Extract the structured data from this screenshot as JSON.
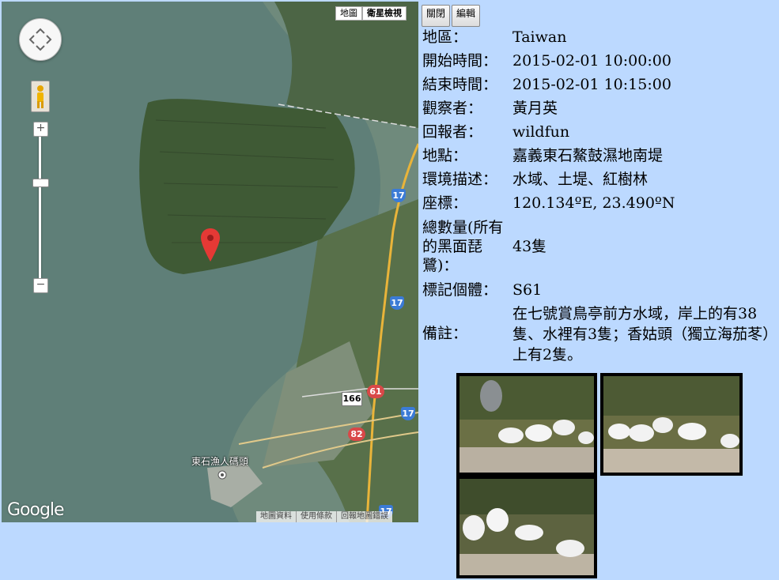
{
  "map": {
    "type_buttons": [
      "地圖",
      "衛星檢視"
    ],
    "zoom_in": "+",
    "zoom_out": "−",
    "logo": "Google",
    "place_label": "東石漁人碼頭",
    "footer": [
      "地圖資料",
      "使用條款",
      "回報地圖錯誤"
    ],
    "road_shields": {
      "r17a": "17",
      "r17b": "17",
      "r17c": "17",
      "r17d": "17",
      "r61": "61",
      "r82": "82",
      "r166": "166"
    }
  },
  "panel": {
    "buttons": [
      "關閉",
      "編輯"
    ],
    "rows": [
      {
        "key": "地區：",
        "value": "Taiwan"
      },
      {
        "key": "開始時間：",
        "value": "2015-02-01 10:00:00"
      },
      {
        "key": "結束時間：",
        "value": "2015-02-01 10:15:00"
      },
      {
        "key": "觀察者：",
        "value": "黃月英"
      },
      {
        "key": "回報者：",
        "value": "wildfun"
      },
      {
        "key": "地點：",
        "value": "嘉義東石鰲鼓濕地南堤"
      },
      {
        "key": "環境描述：",
        "value": "水域、土堤、紅樹林"
      },
      {
        "key": "座標：",
        "value": "120.134ºE, 23.490ºN"
      },
      {
        "key": "總數量(所有的黑面琵鷺)：",
        "value": "43隻"
      },
      {
        "key": "標記個體：",
        "value": "S61"
      },
      {
        "key": "備註：",
        "value": "在七號賞鳥亭前方水域，岸上的有38隻、水裡有3隻；香姑頭（獨立海茄苳）上有2隻。"
      }
    ]
  },
  "photos": [
    "spoonbills-photo-1",
    "spoonbills-photo-2",
    "spoonbills-photo-3"
  ],
  "colors": {
    "background": "#bcd9ff",
    "water": "#5f7f78",
    "land": "#3f5a35",
    "marker": "#e53935"
  }
}
